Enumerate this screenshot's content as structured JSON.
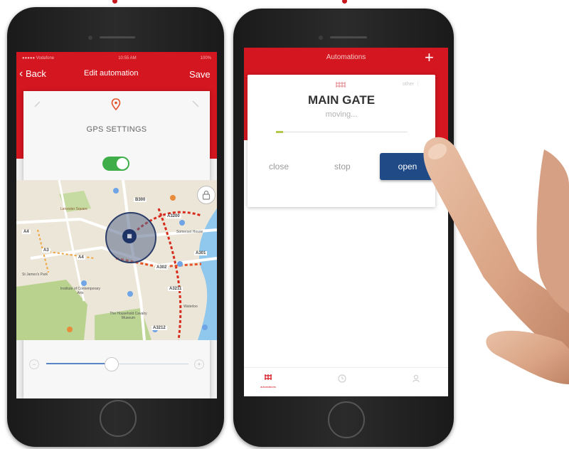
{
  "left_phone": {
    "status": {
      "carrier": "●●●●● Vodafone",
      "time": "10:55 AM",
      "battery": "100%"
    },
    "nav": {
      "back_label": "Back",
      "title": "Edit automation",
      "save_label": "Save"
    },
    "card_title": "GPS SETTINGS",
    "gps_toggle_on": true,
    "map": {
      "labels": [
        "A4",
        "A4",
        "A3",
        "A302",
        "A3211",
        "A3212",
        "B300",
        "A3200",
        "A301"
      ],
      "places": [
        "Leicester Square",
        "Institute of Contemporary Arts",
        "The Household Cavalry Museum",
        "Somerset House",
        "St James's Park",
        "Waterloo"
      ]
    },
    "radius_slider_level": 0.45,
    "slider_min_icon": "minus-icon",
    "slider_max_icon": "plus-icon"
  },
  "right_phone": {
    "nav": {
      "title": "Automations",
      "add_label": "+"
    },
    "device": {
      "name": "MAIN GATE",
      "status": "moving...",
      "menu_label": "other",
      "progress": 0.05
    },
    "actions": {
      "close_label": "close",
      "stop_label": "stop",
      "open_label": "open"
    },
    "tabs": [
      {
        "icon": "gate-icon",
        "label": "automations"
      },
      {
        "icon": "clock-icon",
        "label": ""
      },
      {
        "icon": "user-icon",
        "label": ""
      }
    ]
  },
  "colors": {
    "brand_red": "#d3161f",
    "accent_blue": "#1f4a86",
    "toggle_green": "#3fae49"
  }
}
